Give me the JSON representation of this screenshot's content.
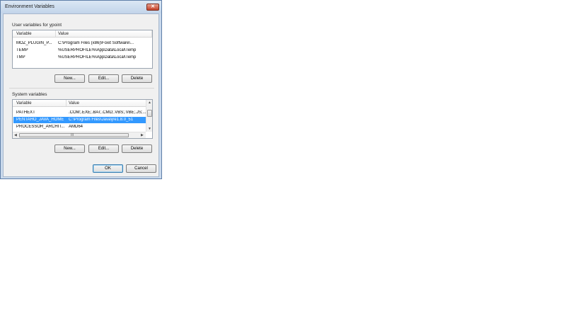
{
  "window": {
    "title": "Environment Variables"
  },
  "user_vars": {
    "group_label": "User variables for ypoint",
    "columns": [
      "Variable",
      "Value"
    ],
    "rows": [
      {
        "variable": "MOZ_PLUGIN_P...",
        "value": "C:\\Program Files (x86)\\Foxit Software\\..."
      },
      {
        "variable": "TEMP",
        "value": "%USERPROFILE%\\AppData\\Local\\Temp"
      },
      {
        "variable": "TMP",
        "value": "%USERPROFILE%\\AppData\\Local\\Temp"
      }
    ],
    "buttons": {
      "new": "New...",
      "edit": "Edit...",
      "delete": "Delete"
    }
  },
  "system_vars": {
    "group_label": "System variables",
    "columns": [
      "Variable",
      "Value"
    ],
    "rows": [
      {
        "variable": "PATHEXT",
        "value": ".COM;.EXE;.BAT;.CMD;.VBS;.VBE;.JS;..."
      },
      {
        "variable": "PENTAHO_JAVA_HOME",
        "value": "C:\\Program Files\\Java\\jre1.8.0_51",
        "selected": true
      },
      {
        "variable": "PROCESSOR_ARCHIT...",
        "value": "AMD64"
      }
    ],
    "buttons": {
      "new": "New...",
      "edit": "Edit...",
      "delete": "Delete"
    },
    "scroll_grip": "III"
  },
  "footer": {
    "ok": "OK",
    "cancel": "Cancel"
  },
  "icons": {
    "close": "close-icon",
    "scroll_up": "arrow-up-icon",
    "scroll_down": "arrow-down-icon",
    "scroll_left": "arrow-left-icon",
    "scroll_right": "arrow-right-icon"
  },
  "colors": {
    "selection": "#3399ff",
    "title_bar": "#c9d9ec",
    "close_button": "#c4412a"
  }
}
